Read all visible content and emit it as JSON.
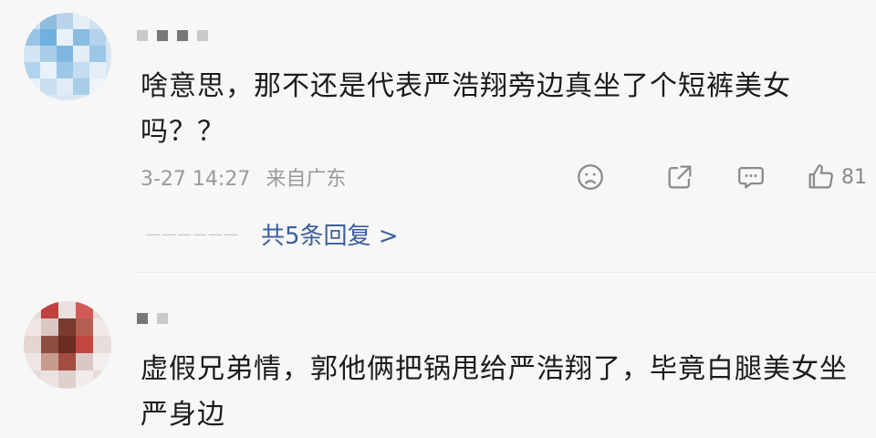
{
  "comments": [
    {
      "text": "啥意思，那不还是代表严浩翔旁边真坐了个短裤美女吗？？",
      "date": "3-27 14:27",
      "location": "来自广东",
      "like_count": "81",
      "replies_label": "共5条回复 >",
      "icons": [
        "dislike-icon",
        "share-icon",
        "comment-icon",
        "like-icon"
      ]
    },
    {
      "text": "虚假兄弟情，郭他俩把锅甩给严浩翔了，毕竟白腿美女坐严身边"
    }
  ],
  "colors": {
    "background": "#f7f7f7",
    "text": "#1b1b1b",
    "meta": "#9a9a9a",
    "link": "#3b5f9a"
  }
}
